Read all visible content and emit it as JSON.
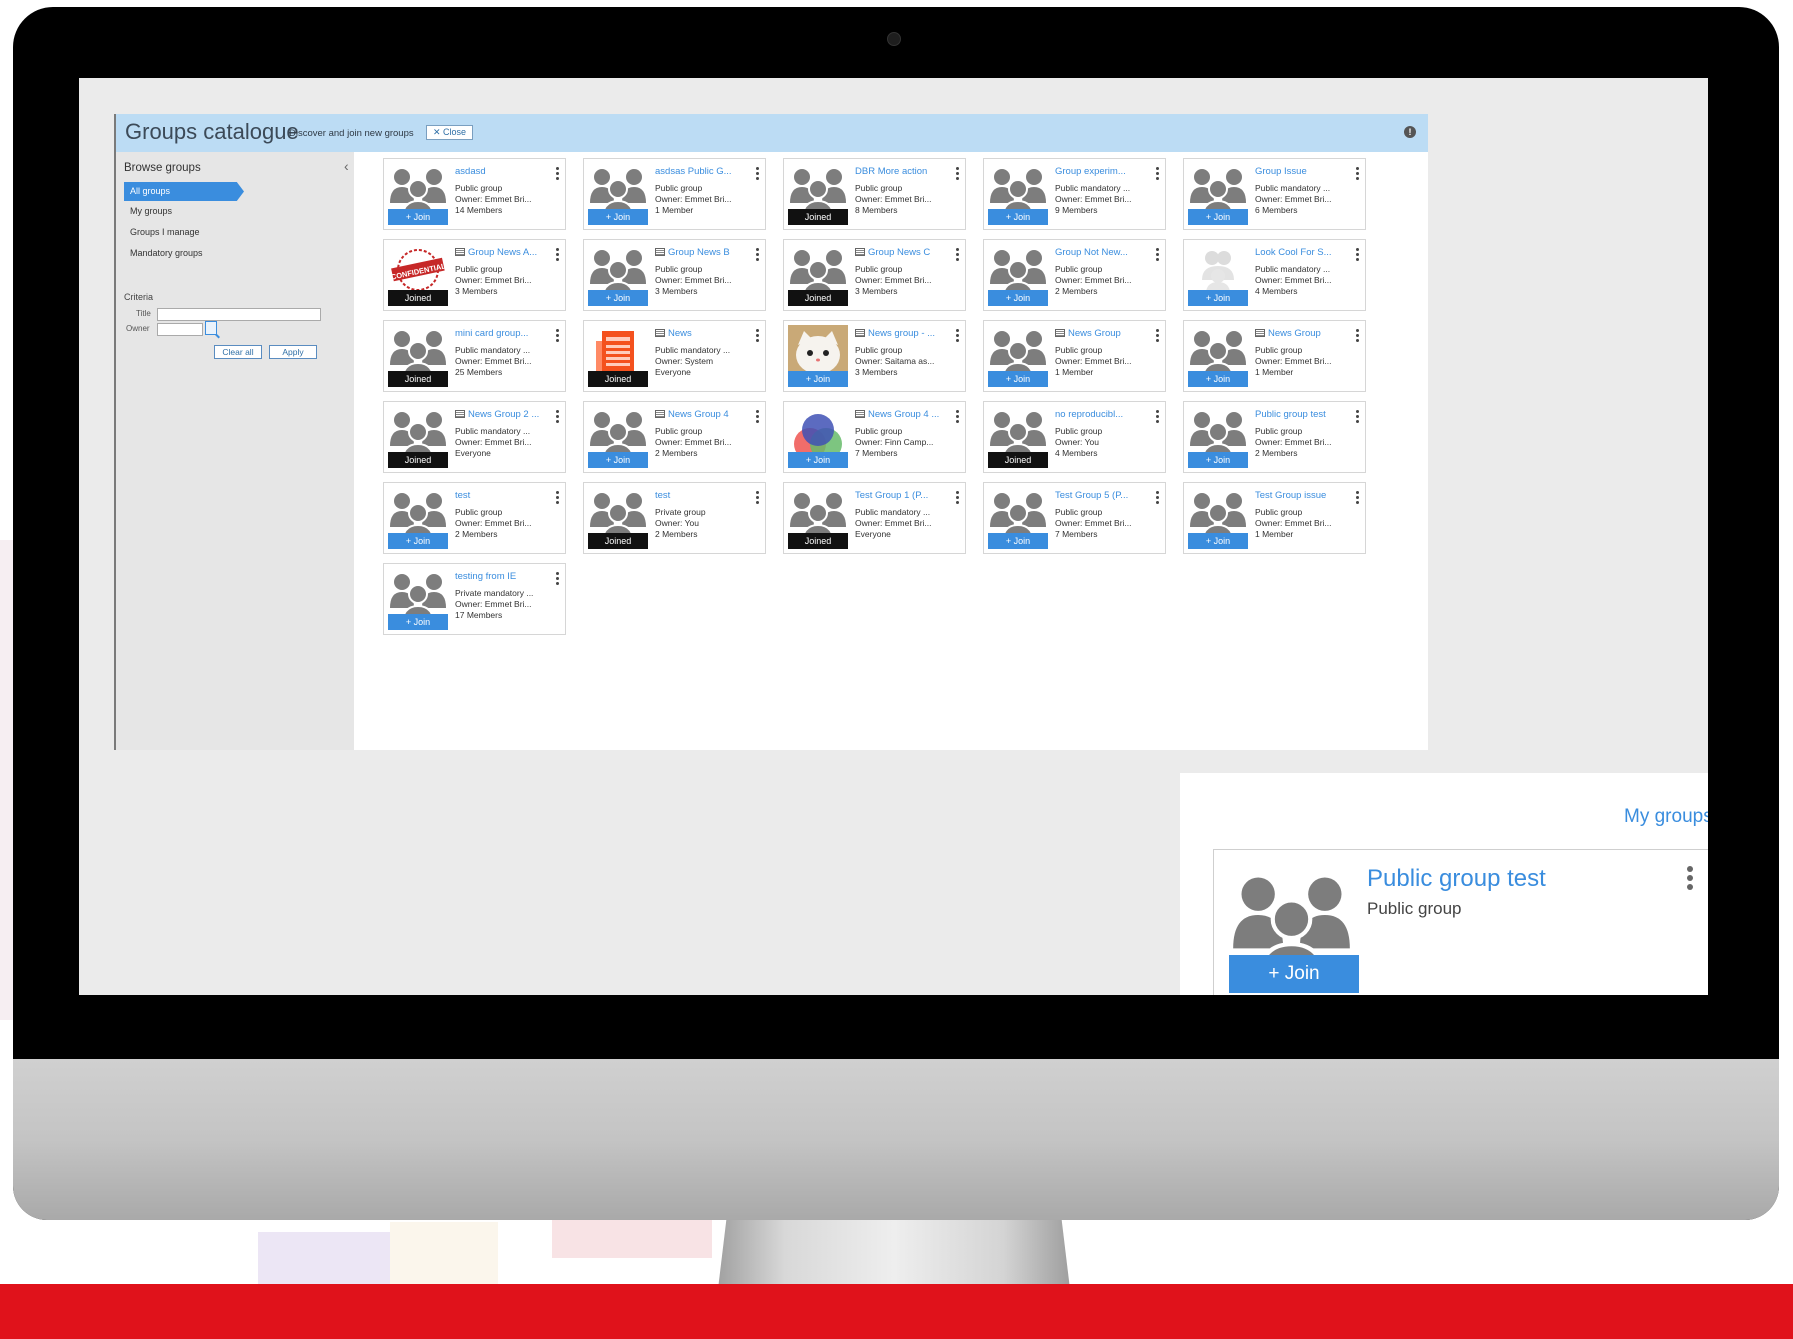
{
  "catalogue": {
    "title": "Groups catalogue",
    "subtitle": "Discover and join new groups",
    "close_label": "✕ Close"
  },
  "sidebar": {
    "title": "Browse groups",
    "items": [
      {
        "label": "All groups",
        "active": true
      },
      {
        "label": "My groups",
        "active": false
      },
      {
        "label": "Groups I manage",
        "active": false
      },
      {
        "label": "Mandatory groups",
        "active": false
      }
    ],
    "criteria_label": "Criteria",
    "title_label": "Title",
    "owner_label": "Owner",
    "clear_label": "Clear all",
    "apply_label": "Apply"
  },
  "groups": [
    {
      "title": "asdasd",
      "news": false,
      "type": "Public group",
      "owner": "Owner: Emmet Bri...",
      "members": "14 Members",
      "status": "+ Join",
      "thumb": "people"
    },
    {
      "title": "asdsas Public G...",
      "news": false,
      "type": "Public group",
      "owner": "Owner: Emmet Bri...",
      "members": "1 Member",
      "status": "+ Join",
      "thumb": "people"
    },
    {
      "title": "DBR More action",
      "news": false,
      "type": "Public group",
      "owner": "Owner: Emmet Bri...",
      "members": "8 Members",
      "status": "Joined",
      "thumb": "people"
    },
    {
      "title": "Group experim...",
      "news": false,
      "type": "Public mandatory ...",
      "owner": "Owner: Emmet Bri...",
      "members": "9 Members",
      "status": "+ Join",
      "thumb": "people"
    },
    {
      "title": "Group Issue",
      "news": false,
      "type": "Public mandatory ...",
      "owner": "Owner: Emmet Bri...",
      "members": "6 Members",
      "status": "+ Join",
      "thumb": "people"
    },
    {
      "title": "Group News A...",
      "news": true,
      "type": "Public group",
      "owner": "Owner: Emmet Bri...",
      "members": "3 Members",
      "status": "Joined",
      "thumb": "confidential"
    },
    {
      "title": "Group News B",
      "news": true,
      "type": "Public group",
      "owner": "Owner: Emmet Bri...",
      "members": "3 Members",
      "status": "+ Join",
      "thumb": "people"
    },
    {
      "title": "Group News C",
      "news": true,
      "type": "Public group",
      "owner": "Owner: Emmet Bri...",
      "members": "3 Members",
      "status": "Joined",
      "thumb": "people"
    },
    {
      "title": "Group Not New...",
      "news": false,
      "type": "Public group",
      "owner": "Owner: Emmet Bri...",
      "members": "2 Members",
      "status": "+ Join",
      "thumb": "people"
    },
    {
      "title": "Look Cool For S...",
      "news": false,
      "type": "Public mandatory ...",
      "owner": "Owner: Emmet Bri...",
      "members": "4 Members",
      "status": "+ Join",
      "thumb": "faded"
    },
    {
      "title": "mini card group...",
      "news": false,
      "type": "Public mandatory ...",
      "owner": "Owner: Emmet Bri...",
      "members": "25 Members",
      "status": "Joined",
      "thumb": "people"
    },
    {
      "title": "News",
      "news": true,
      "type": "Public mandatory ...",
      "owner": "Owner: System",
      "members": "Everyone",
      "status": "Joined",
      "thumb": "document"
    },
    {
      "title": "News group - ...",
      "news": true,
      "type": "Public group",
      "owner": "Owner: Saitama as...",
      "members": "3 Members",
      "status": "+ Join",
      "thumb": "cat"
    },
    {
      "title": "News Group",
      "news": true,
      "type": "Public group",
      "owner": "Owner: Emmet Bri...",
      "members": "1 Member",
      "status": "+ Join",
      "thumb": "people"
    },
    {
      "title": "News Group",
      "news": true,
      "type": "Public group",
      "owner": "Owner: Emmet Bri...",
      "members": "1 Member",
      "status": "+ Join",
      "thumb": "people"
    },
    {
      "title": "News Group 2 ...",
      "news": true,
      "type": "Public mandatory ...",
      "owner": "Owner: Emmet Bri...",
      "members": "Everyone",
      "status": "Joined",
      "thumb": "people"
    },
    {
      "title": "News Group 4",
      "news": true,
      "type": "Public group",
      "owner": "Owner: Emmet Bri...",
      "members": "2 Members",
      "status": "+ Join",
      "thumb": "people"
    },
    {
      "title": "News Group 4 ...",
      "news": true,
      "type": "Public group",
      "owner": "Owner: Finn Camp...",
      "members": "7 Members",
      "status": "+ Join",
      "thumb": "circles"
    },
    {
      "title": "no reproducibl...",
      "news": false,
      "type": "Public group",
      "owner": "Owner: You",
      "members": "4 Members",
      "status": "Joined",
      "thumb": "people"
    },
    {
      "title": "Public group test",
      "news": false,
      "type": "Public group",
      "owner": "Owner: Emmet Bri...",
      "members": "2 Members",
      "status": "+ Join",
      "thumb": "people"
    },
    {
      "title": "test",
      "news": false,
      "type": "Public group",
      "owner": "Owner: Emmet Bri...",
      "members": "2 Members",
      "status": "+ Join",
      "thumb": "people"
    },
    {
      "title": "test",
      "news": false,
      "type": "Private group",
      "owner": "Owner: You",
      "members": "2 Members",
      "status": "Joined",
      "thumb": "people"
    },
    {
      "title": "Test Group 1 (P...",
      "news": false,
      "type": "Public mandatory ...",
      "owner": "Owner: Emmet Bri...",
      "members": "Everyone",
      "status": "Joined",
      "thumb": "people"
    },
    {
      "title": "Test Group 5 (P...",
      "news": false,
      "type": "Public group",
      "owner": "Owner: Emmet Bri...",
      "members": "7 Members",
      "status": "+ Join",
      "thumb": "people"
    },
    {
      "title": "Test Group issue",
      "news": false,
      "type": "Public group",
      "owner": "Owner: Emmet Bri...",
      "members": "1 Member",
      "status": "+ Join",
      "thumb": "people"
    },
    {
      "title": "testing from IE",
      "news": false,
      "type": "Private mandatory ...",
      "owner": "Owner: Emmet Bri...",
      "members": "17 Members",
      "status": "+ Join",
      "thumb": "people"
    }
  ],
  "my_groups": {
    "title": "My groups",
    "card_title": "Public group test",
    "card_type": "Public group",
    "join_label": "+ Join"
  },
  "colors": {
    "accent": "#3a8dde",
    "header_bg": "#bcdcf4",
    "joined_bg": "#111111",
    "brand_red": "#e0121b"
  }
}
